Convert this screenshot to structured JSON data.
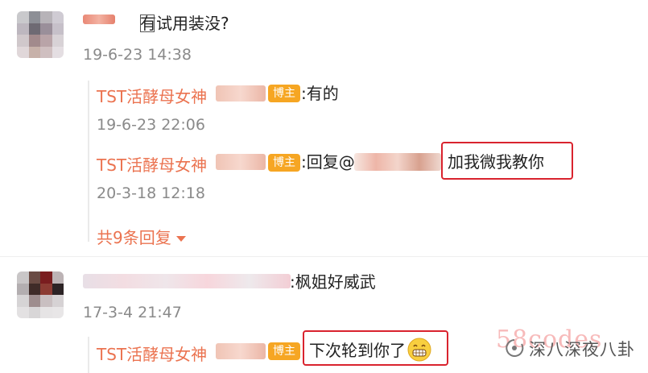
{
  "comment1": {
    "text": "有试用装没?",
    "timestamp": "19-6-23 14:38",
    "replies": [
      {
        "author": "TST活酵母女神",
        "badge": "博主",
        "text": ":有的",
        "timestamp": "19-6-23 22:06"
      },
      {
        "author": "TST活酵母女神",
        "badge": "博主",
        "text_prefix": ":回复@",
        "text_highlight": "加我微我教你",
        "timestamp": "20-3-18 12:18"
      }
    ],
    "more_replies": "共9条回复"
  },
  "comment2": {
    "text": ":枫姐好威武",
    "timestamp": "17-3-4 21:47",
    "reply": {
      "author": "TST活酵母女神",
      "badge": "博主",
      "text": "下次轮到你了"
    }
  },
  "watermark": {
    "brand": "58codes",
    "channel": "深八深夜八卦"
  },
  "colors": {
    "accent": "#eb7350",
    "badge": "#f6a623",
    "highlight_box": "#d9232e"
  }
}
